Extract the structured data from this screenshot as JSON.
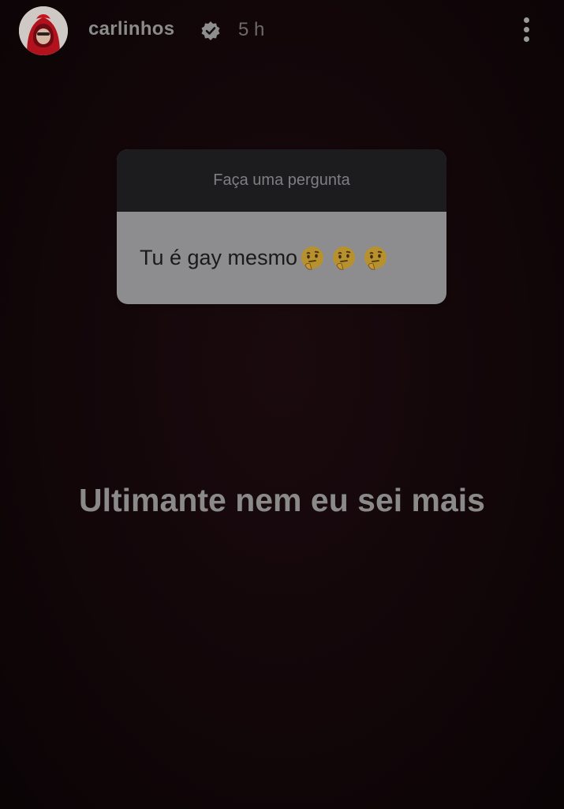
{
  "header": {
    "username": "carlinhos",
    "time": "5 h",
    "avatar_icon": "avatar-red-hood",
    "verified_icon": "verified-badge-icon",
    "more_icon": "more-vertical-icon"
  },
  "question_sticker": {
    "prompt": "Faça uma pergunta",
    "question": "Tu é gay mesmo",
    "emojis": [
      "thinking-face",
      "thinking-face",
      "thinking-face"
    ]
  },
  "caption": "Ultimante nem eu sei mais",
  "colors": {
    "background": "#120609",
    "sticker_header": "#1c1b1e",
    "sticker_body": "#8d8c8e",
    "text": "#8a8a8a"
  }
}
